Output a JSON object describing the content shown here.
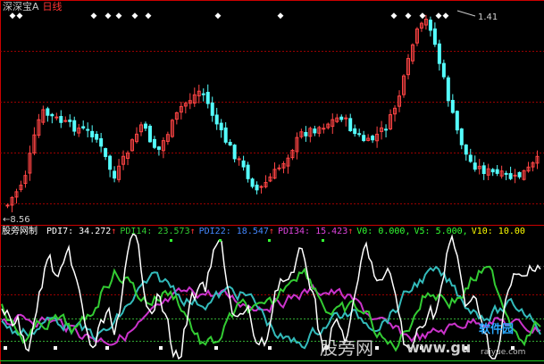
{
  "window": {
    "title": "深深宝A",
    "period_label": "日线"
  },
  "price_panel": {
    "peak_label": "1.41",
    "low_label": "8.56",
    "signal_marker": "◆",
    "candle_count": 120,
    "colors": {
      "up": "#ff4444",
      "down": "#54ffff",
      "grid": "#990000",
      "border": "#cc0000"
    }
  },
  "indicator_panel": {
    "name": "股旁网制",
    "readouts": [
      {
        "label": "PDI7:",
        "value": "34.272",
        "arrow": "↑",
        "color": "#ffffff"
      },
      {
        "label": "PDI14:",
        "value": "23.573",
        "arrow": "↑",
        "color": "#33cc33"
      },
      {
        "label": "PDI22:",
        "value": "18.547",
        "arrow": "↑",
        "color": "#4488ff"
      },
      {
        "label": "PDI34:",
        "value": "15.423",
        "arrow": "↑",
        "color": "#dd44dd"
      },
      {
        "label": "V0:",
        "value": "0.000,",
        "arrow": "",
        "color": "#33ff33"
      },
      {
        "label": "V5:",
        "value": "5.000,",
        "arrow": "",
        "color": "#33ff33"
      },
      {
        "label": "V10:",
        "value": "10.00",
        "arrow": "",
        "color": "#ffff00"
      }
    ],
    "series_colors": {
      "pdi7": "#ffffff",
      "pdi14": "#33cc33",
      "pdi22": "#33bbbb",
      "pdi34": "#cc33cc",
      "levels": "#33ff33"
    }
  },
  "watermarks": {
    "cn": "股旁网",
    "url": "www.gu",
    "logo": "软件园",
    "domain": "raiyue.com"
  }
}
